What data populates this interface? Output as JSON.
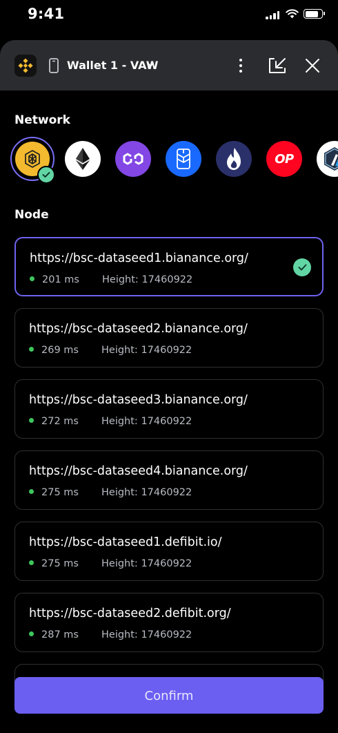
{
  "status_bar": {
    "time": "9:41",
    "battery_level": 0.85
  },
  "header": {
    "wallet_label": "Wallet 1 - VAW",
    "icons": [
      "binance-logo",
      "device-icon",
      "chevron-down-icon",
      "more-icon",
      "minimize-icon",
      "close-icon"
    ]
  },
  "network": {
    "label": "Network",
    "items": [
      {
        "name": "BNB Chain",
        "icon": "bnb-icon",
        "color": "#f3ba2f",
        "selected": true
      },
      {
        "name": "Ethereum",
        "icon": "ethereum-icon",
        "color": "#ffffff"
      },
      {
        "name": "Polygon",
        "icon": "polygon-icon",
        "color": "#8247e5"
      },
      {
        "name": "Fantom",
        "icon": "fantom-icon",
        "color": "#1969ff"
      },
      {
        "name": "HECO",
        "icon": "heco-icon",
        "color": "#2a3069"
      },
      {
        "name": "Optimism",
        "icon": "optimism-icon",
        "color": "#ff0420",
        "text": "OP"
      },
      {
        "name": "Arbitrum",
        "icon": "arbitrum-icon",
        "color": "#ffffff"
      }
    ]
  },
  "node": {
    "label": "Node",
    "height_label": "Height:",
    "items": [
      {
        "url": "https://bsc-dataseed1.bianance.org/",
        "latency": "201 ms",
        "height": "17460922",
        "selected": true
      },
      {
        "url": "https://bsc-dataseed2.bianance.org/",
        "latency": "269 ms",
        "height": "17460922"
      },
      {
        "url": "https://bsc-dataseed3.bianance.org/",
        "latency": "272 ms",
        "height": "17460922"
      },
      {
        "url": "https://bsc-dataseed4.bianance.org/",
        "latency": "275 ms",
        "height": "17460922"
      },
      {
        "url": "https://bsc-dataseed1.defibit.io/",
        "latency": "275 ms",
        "height": "17460922"
      },
      {
        "url": "https://bsc-dataseed2.defibit.org/",
        "latency": "287 ms",
        "height": "17460922"
      }
    ]
  },
  "confirm_label": "Confirm",
  "colors": {
    "accent": "#6b5ff2",
    "success": "#62d5a4",
    "online_dot": "#3ec75d",
    "header_bg": "#2b2c2f"
  }
}
